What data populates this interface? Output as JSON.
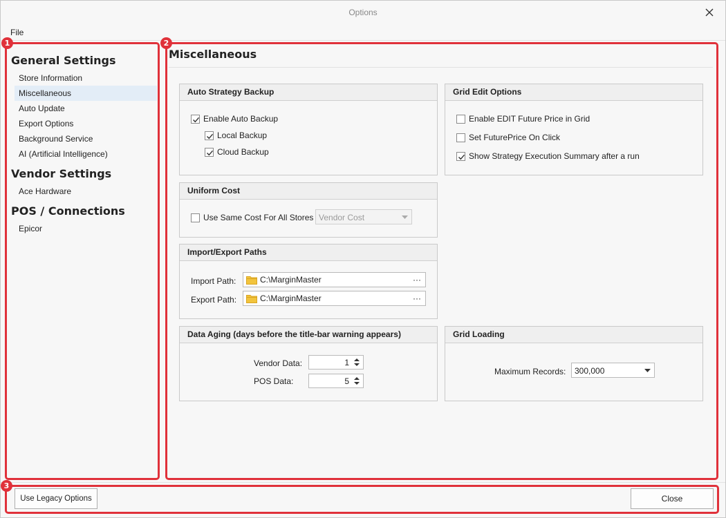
{
  "window": {
    "title": "Options"
  },
  "menu": {
    "file": "File"
  },
  "sidebar": {
    "sections": [
      {
        "heading": "General Settings",
        "items": [
          "Store Information",
          "Miscellaneous",
          "Auto Update",
          "Export Options",
          "Background Service",
          "AI (Artificial Intelligence)"
        ]
      },
      {
        "heading": "Vendor Settings",
        "items": [
          "Ace Hardware"
        ]
      },
      {
        "heading": "POS / Connections",
        "items": [
          "Epicor"
        ]
      }
    ],
    "selected": "Miscellaneous"
  },
  "main": {
    "title": "Miscellaneous",
    "auto_backup": {
      "header": "Auto Strategy Backup",
      "enable": {
        "label": "Enable Auto Backup",
        "checked": true
      },
      "local": {
        "label": "Local Backup",
        "checked": true
      },
      "cloud": {
        "label": "Cloud Backup",
        "checked": true
      }
    },
    "grid_edit": {
      "header": "Grid Edit Options",
      "future_price": {
        "label": "Enable EDIT Future Price in Grid",
        "checked": false
      },
      "set_future": {
        "label": "Set FuturePrice On Click",
        "checked": false
      },
      "summary": {
        "label": "Show Strategy Execution Summary after a run",
        "checked": true
      }
    },
    "uniform_cost": {
      "header": "Uniform Cost",
      "same_cost": {
        "label": "Use Same Cost For All Stores",
        "checked": false
      },
      "cost_source": "Vendor Cost"
    },
    "paths": {
      "header": "Import/Export Paths",
      "import_label": "Import Path:",
      "import_value": "C:\\MarginMaster",
      "export_label": "Export Path:",
      "export_value": "C:\\MarginMaster",
      "browse": "···"
    },
    "data_aging": {
      "header": "Data Aging (days before the title-bar warning appears)",
      "vendor_label": "Vendor Data:",
      "vendor_value": "1",
      "pos_label": "POS Data:",
      "pos_value": "5"
    },
    "grid_loading": {
      "header": "Grid Loading",
      "max_label": "Maximum Records:",
      "max_value": "300,000"
    }
  },
  "footer": {
    "legacy_button": "Use Legacy Options",
    "close_button": "Close"
  },
  "annotations": {
    "badge1": "1",
    "badge2": "2",
    "badge3": "3"
  },
  "colors": {
    "annotation": "#e0313a",
    "selected_bg": "#e3edf7",
    "folder": "#f2c43d"
  }
}
